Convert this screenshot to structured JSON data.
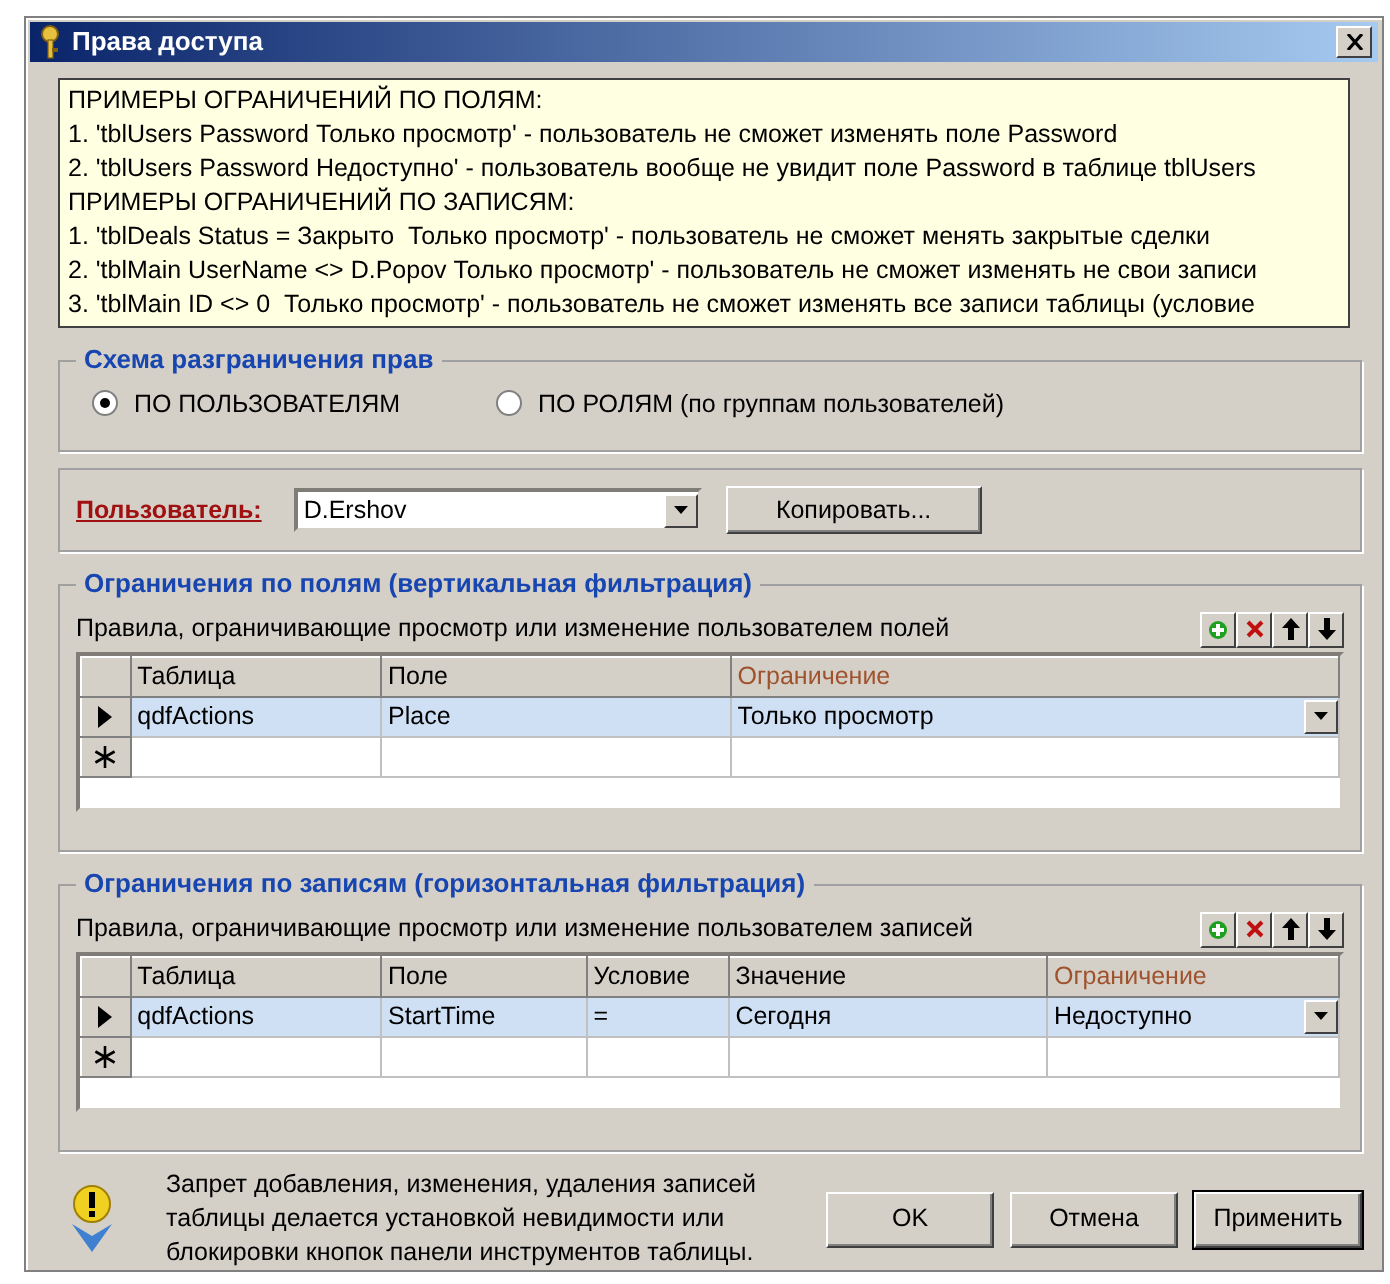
{
  "window": {
    "title": "Права доступа"
  },
  "info_lines": [
    "ПРИМЕРЫ ОГРАНИЧЕНИЙ ПО ПОЛЯМ:",
    "1. 'tblUsers Password Только просмотр' - пользователь не сможет изменять поле Password",
    "2. 'tblUsers Password Недоступно' - пользователь вообще не увидит поле Password в таблице tblUsers",
    "ПРИМЕРЫ ОГРАНИЧЕНИЙ ПО ЗАПИСЯМ:",
    "1. 'tblDeals Status = Закрыто  Только просмотр' - пользователь не сможет менять закрытые сделки",
    "2. 'tblMain UserName <> D.Popov Только просмотр' - пользователь не сможет изменять не свои записи",
    "3. 'tblMain ID <> 0  Только просмотр' - пользователь не сможет изменять все записи таблицы (условие"
  ],
  "scheme": {
    "title": "Схема разграничения прав",
    "options": [
      {
        "label": "ПО ПОЛЬЗОВАТЕЛЯМ",
        "selected": true
      },
      {
        "label": "ПО РОЛЯМ (по группам пользователей)",
        "selected": false
      }
    ]
  },
  "user": {
    "label": "Пользователь:",
    "value": "D.Ershov",
    "copy_button": "Копировать..."
  },
  "sections": [
    {
      "title": "Ограничения по полям (вертикальная фильтрация)",
      "description": "Правила, ограничивающие просмотр или изменение пользователем полей",
      "columns": [
        {
          "label": "Таблица",
          "color": "#000000"
        },
        {
          "label": "Поле",
          "color": "#000000"
        },
        {
          "label": "Ограничение",
          "color": "#a0522d"
        }
      ],
      "rows": [
        {
          "kind": "data",
          "selected": true,
          "cells": [
            "qdfActions",
            "Place",
            "Только просмотр"
          ]
        },
        {
          "kind": "new",
          "selected": false
        }
      ]
    },
    {
      "title": "Ограничения по записям (горизонтальная фильтрация)",
      "description": "Правила, ограничивающие просмотр или изменение пользователем записей",
      "columns": [
        {
          "label": "Таблица",
          "color": "#000000"
        },
        {
          "label": "Поле",
          "color": "#000000"
        },
        {
          "label": "Условие",
          "color": "#000000"
        },
        {
          "label": "Значение",
          "color": "#000000"
        },
        {
          "label": "Ограничение",
          "color": "#a0522d"
        }
      ],
      "rows": [
        {
          "kind": "data",
          "selected": true,
          "cells": [
            "qdfActions",
            "StartTime",
            "=",
            "Сегодня",
            "Недоступно"
          ]
        },
        {
          "kind": "new",
          "selected": false
        }
      ]
    }
  ],
  "footer": {
    "hint": "Запрет добавления, изменения, удаления записей таблицы делается установкой невидимости или блокировки кнопок панели инструментов таблицы.",
    "buttons": [
      {
        "label": "OK",
        "default": false
      },
      {
        "label": "Отмена",
        "default": false
      },
      {
        "label": "Применить",
        "default": true
      }
    ]
  }
}
